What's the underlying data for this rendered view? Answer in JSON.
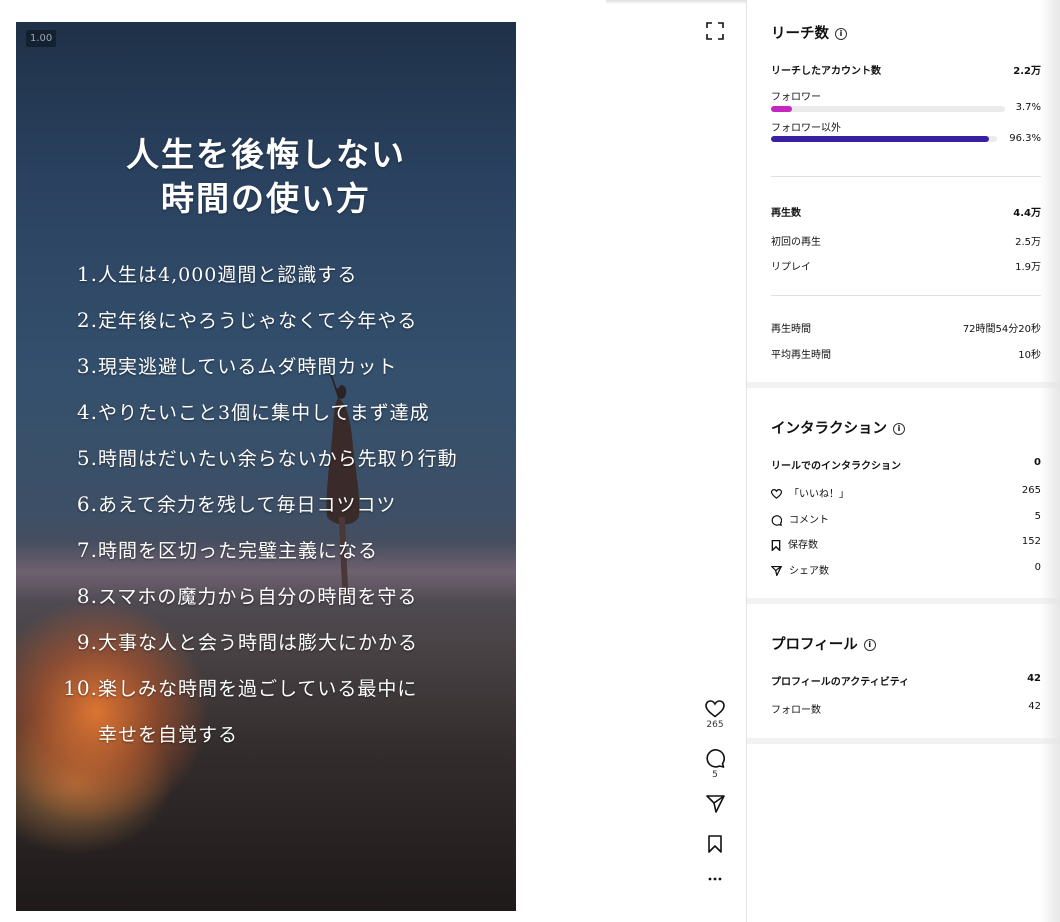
{
  "video": {
    "zoom": "1.00",
    "title_line1": "人生を後悔しない",
    "title_line2": "時間の使い方",
    "items": [
      {
        "num": "1.",
        "text": "人生は4,000週間と認識する"
      },
      {
        "num": "2.",
        "text": "定年後にやろうじゃなくて今年やる"
      },
      {
        "num": "3.",
        "text": "現実逃避しているムダ時間カット"
      },
      {
        "num": "4.",
        "text": "やりたいこと3個に集中してまず達成"
      },
      {
        "num": "5.",
        "text": "時間はだいたい余らないから先取り行動"
      },
      {
        "num": "6.",
        "text": "あえて余力を残して毎日コツコツ"
      },
      {
        "num": "7.",
        "text": "時間を区切った完璧主義になる"
      },
      {
        "num": "8.",
        "text": "スマホの魔力から自分の時間を守る"
      },
      {
        "num": "9.",
        "text": "大事な人と会う時間は膨大にかかる"
      },
      {
        "num": "10.",
        "text": "楽しみな時間を過ごしている最中に"
      },
      {
        "num": "",
        "text": "幸せを自覚する"
      }
    ]
  },
  "actions": {
    "like_count": "265",
    "comment_count": "5",
    "icons": [
      "fullscreen-icon",
      "heart-icon",
      "comment-icon",
      "share-icon",
      "bookmark-icon",
      "more-icon"
    ]
  },
  "reach": {
    "title": "リーチ数",
    "accounts_label": "リーチしたアカウント数",
    "accounts_value": "2.2万",
    "followers_label": "フォロワー",
    "followers_pct": "3.7%",
    "followers_fraction": 0.037,
    "non_followers_label": "フォロワー以外",
    "non_followers_pct": "96.3%",
    "non_followers_fraction": 0.963,
    "colors": {
      "followers": "#c626c0",
      "non_followers": "#3b1fa3"
    },
    "plays_label": "再生数",
    "plays_value": "4.4万",
    "initial_label": "初回の再生",
    "initial_value": "2.5万",
    "replay_label": "リプレイ",
    "replay_value": "1.9万",
    "watch_time_label": "再生時間",
    "watch_time_value": "72時間54分20秒",
    "avg_watch_label": "平均再生時間",
    "avg_watch_value": "10秒"
  },
  "interaction": {
    "title": "インタラクション",
    "reel_label": "リールでのインタラクション",
    "reel_value": "0",
    "likes_label": "「いいね！」",
    "likes_value": "265",
    "comments_label": "コメント",
    "comments_value": "5",
    "saves_label": "保存数",
    "saves_value": "152",
    "shares_label": "シェア数",
    "shares_value": "0"
  },
  "profile": {
    "title": "プロフィール",
    "activity_label": "プロフィールのアクティビティ",
    "activity_value": "42",
    "follows_label": "フォロー数",
    "follows_value": "42"
  },
  "info_icon_glyph": "i"
}
